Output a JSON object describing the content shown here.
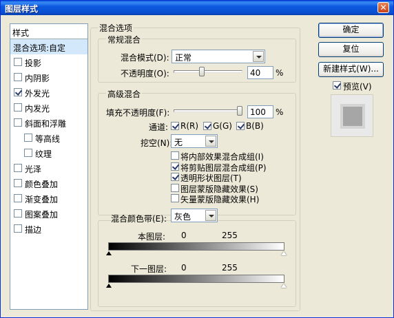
{
  "window": {
    "title": "图层样式",
    "close_glyph": "✕"
  },
  "style_list": {
    "header": "样式",
    "items": [
      {
        "label": "混合选项:自定",
        "checkbox": false,
        "checked": false,
        "selected": true
      },
      {
        "label": "投影",
        "checkbox": true,
        "checked": false
      },
      {
        "label": "内阴影",
        "checkbox": true,
        "checked": false
      },
      {
        "label": "外发光",
        "checkbox": true,
        "checked": true
      },
      {
        "label": "内发光",
        "checkbox": true,
        "checked": false
      },
      {
        "label": "斜面和浮雕",
        "checkbox": true,
        "checked": false
      },
      {
        "label": "等高线",
        "checkbox": true,
        "checked": false,
        "indent": true
      },
      {
        "label": "纹理",
        "checkbox": true,
        "checked": false,
        "indent": true
      },
      {
        "label": "光泽",
        "checkbox": true,
        "checked": false
      },
      {
        "label": "颜色叠加",
        "checkbox": true,
        "checked": false
      },
      {
        "label": "渐变叠加",
        "checkbox": true,
        "checked": false
      },
      {
        "label": "图案叠加",
        "checkbox": true,
        "checked": false
      },
      {
        "label": "描边",
        "checkbox": true,
        "checked": false
      }
    ]
  },
  "blending": {
    "title": "混合选项",
    "general": {
      "title": "常规混合",
      "mode_label": "混合模式(D):",
      "mode_value": "正常",
      "opacity_label": "不透明度(O):",
      "opacity_value": "40",
      "opacity_fraction": 0.4,
      "percent": "%"
    },
    "advanced": {
      "title": "高级混合",
      "fill_label": "填充不透明度(F):",
      "fill_value": "100",
      "fill_fraction": 1.0,
      "percent": "%",
      "channels_label": "通道:",
      "channel_r": "R(R)",
      "channel_g": "G(G)",
      "channel_b": "B(B)",
      "knockout_label": "挖空(N):",
      "knockout_value": "无",
      "options": [
        {
          "label": "将内部效果混合成组(I)",
          "checked": false
        },
        {
          "label": "将剪贴图层混合成组(P)",
          "checked": true
        },
        {
          "label": "透明形状图层(T)",
          "checked": true
        },
        {
          "label": "图层蒙版隐藏效果(S)",
          "checked": false
        },
        {
          "label": "矢量蒙版隐藏效果(H)",
          "checked": false
        }
      ]
    },
    "blend_if": {
      "label": "混合颜色带(E):",
      "value": "灰色",
      "this_layer_label": "本图层:",
      "this_layer_min": "0",
      "this_layer_max": "255",
      "underlying_label": "下一图层:",
      "underlying_min": "0",
      "underlying_max": "255"
    }
  },
  "buttons": {
    "ok": "确定",
    "reset": "复位",
    "new_style": "新建样式(W)...",
    "preview_label": "预览(V)",
    "preview_checked": true
  }
}
